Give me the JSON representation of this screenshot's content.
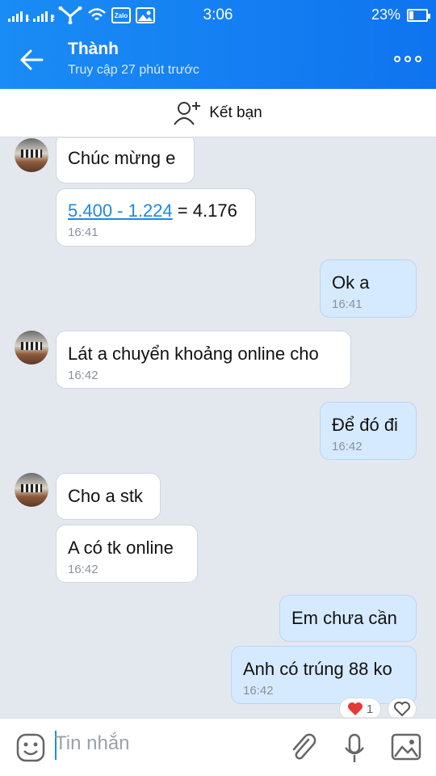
{
  "status": {
    "time": "3:06",
    "battery": "23%",
    "battery_fraction": 0.23,
    "app_badge": "Zalo"
  },
  "header": {
    "title": "Thành",
    "subtitle": "Truy cập 27 phút trước"
  },
  "friend_bar": {
    "label": "Kết bạn"
  },
  "messages": [
    {
      "side": "in",
      "text": "Chúc mừng e"
    },
    {
      "side": "in",
      "link": "5.400 - 1.224",
      "text": " = 4.176",
      "time": "16:41"
    },
    {
      "side": "out",
      "text": "Ok a",
      "time": "16:41"
    },
    {
      "side": "in",
      "text": "Lát a chuyển khoảng online cho",
      "time": "16:42"
    },
    {
      "side": "out",
      "text": "Để đó đi",
      "time": "16:42"
    },
    {
      "side": "in",
      "text": "Cho a stk"
    },
    {
      "side": "in",
      "text": "A có tk online",
      "time": "16:42"
    },
    {
      "side": "out",
      "text": "Em chưa cần"
    },
    {
      "side": "out",
      "text": "Anh có trúng 88 ko",
      "time": "16:42"
    }
  ],
  "reaction": {
    "count": "1"
  },
  "input": {
    "placeholder": "Tin nhắn"
  }
}
